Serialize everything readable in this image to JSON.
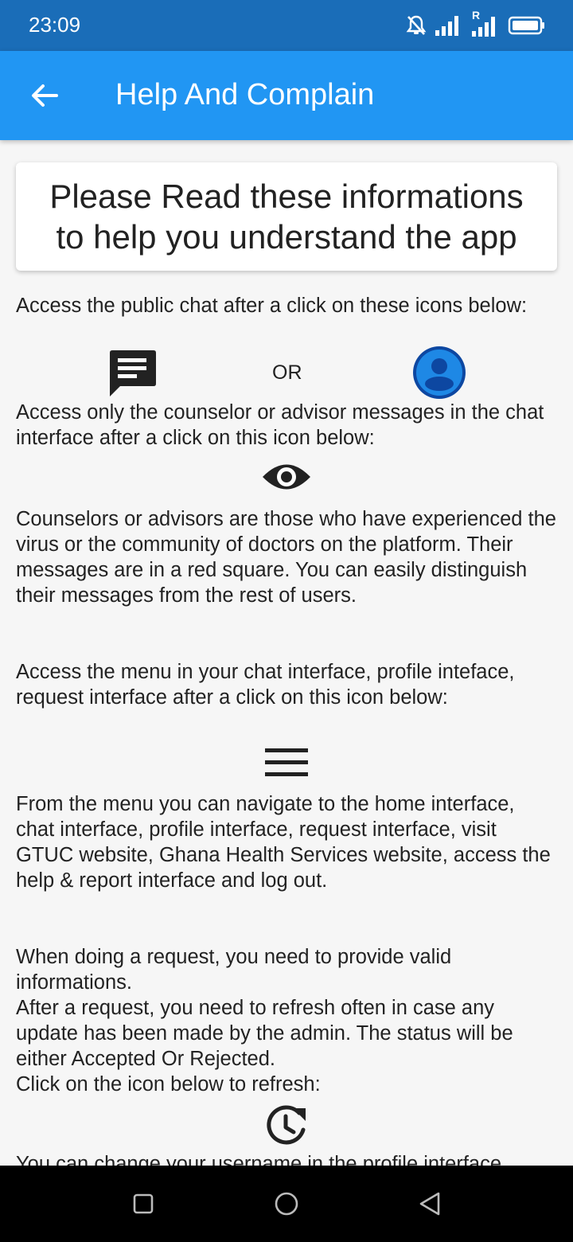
{
  "status_bar": {
    "time": "23:09",
    "icons": [
      "bell-off-icon",
      "signal-icon",
      "roaming-signal-icon",
      "battery-icon"
    ],
    "roaming_mark": "R"
  },
  "app_bar": {
    "title": "Help And Complain",
    "back_icon": "arrow-back-icon",
    "background_color": "#2196f3"
  },
  "content": {
    "card_text": "Please Read these informations to help you understand the app",
    "public_chat_text": "Access the public chat after a click on these icons below:",
    "or_text": "OR",
    "counselor_text": "Access only the counselor or advisor messages  in the chat interface after a click on this icon below:",
    "counselor_info_text": "Counselors or advisors are those who have experienced the virus or the community of doctors on the platform. Their messages are in a red square. You can easily distinguish their messages from the rest of users.",
    "menu_text": "Access the menu in your chat interface, profile inteface, request interface after a click on this icon below:",
    "menu_nav_text": "From the menu you can navigate to the home interface, chat interface, profile interface, request interface, visit GTUC website, Ghana Health Services website, access the help & report interface and log out.",
    "request_text": "When doing a request, you need to provide valid informations.\nAfter a request, you need to refresh often in case any update has been made by the admin. The status will be either Accepted Or Rejected.\nClick on the icon below to refresh:",
    "username_text": "You can change your username in the profile interface"
  },
  "icons": [
    "chat-icon",
    "profile-icon",
    "eye-icon",
    "menu-icon",
    "refresh-clock-icon"
  ],
  "nav_bar": {
    "icons": [
      "recent-apps-icon",
      "home-icon",
      "back-icon"
    ]
  }
}
